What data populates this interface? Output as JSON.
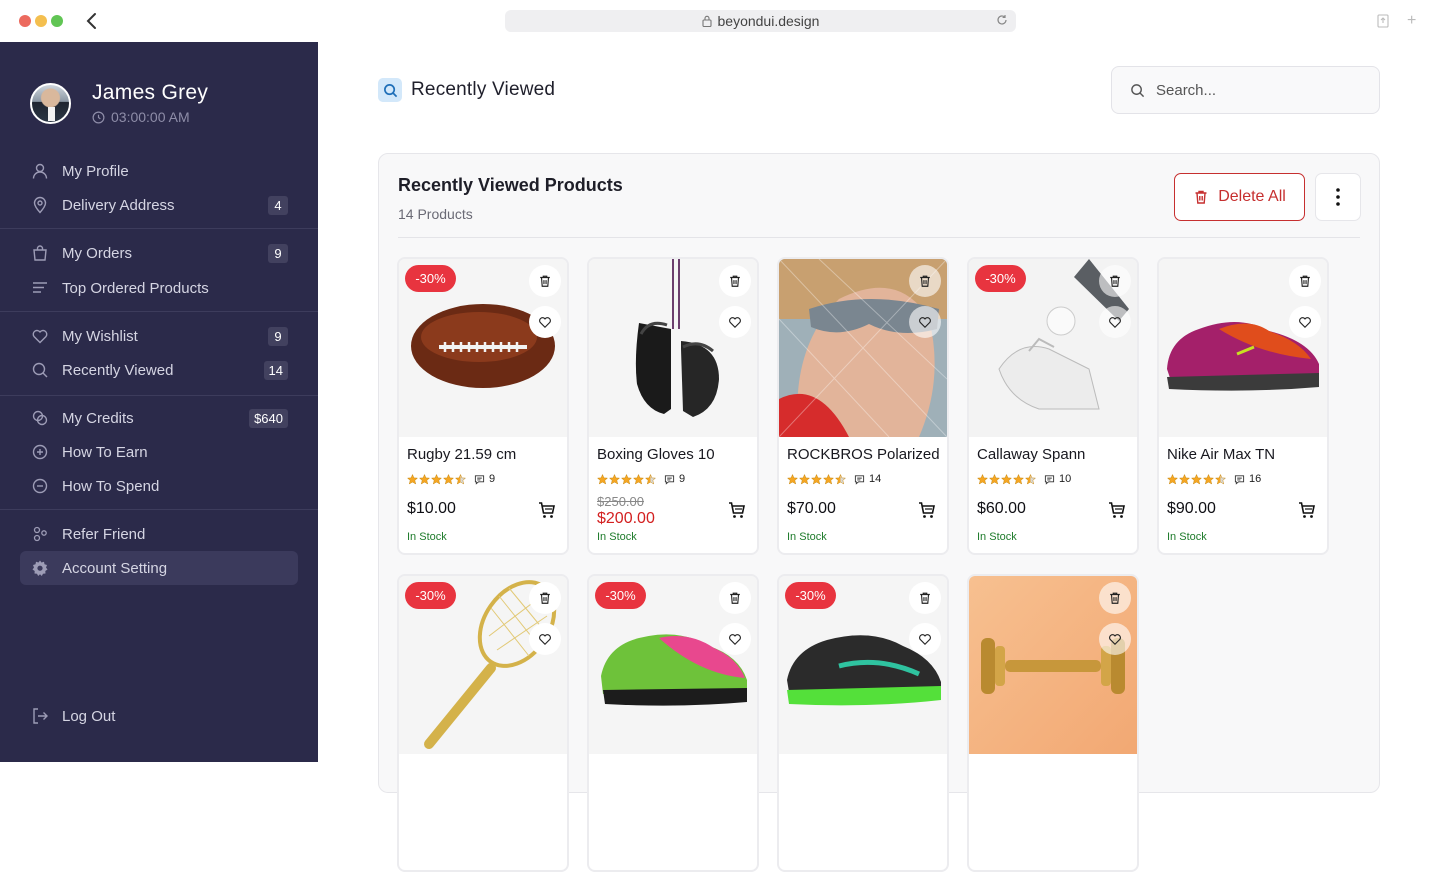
{
  "browser": {
    "url": "beyondui.design"
  },
  "user": {
    "name": "James Grey",
    "time": "03:00:00 AM"
  },
  "sidebar": {
    "items": [
      {
        "label": "My Profile",
        "icon": "user-icon"
      },
      {
        "label": "Delivery Address",
        "icon": "location-pin-icon",
        "badge": "4"
      },
      {
        "label": "My Orders",
        "icon": "shopping-bag-icon",
        "badge": "9"
      },
      {
        "label": "Top Ordered Products",
        "icon": "list-lines-icon"
      },
      {
        "label": "My Wishlist",
        "icon": "heart-icon",
        "badge": "9"
      },
      {
        "label": "Recently Viewed",
        "icon": "search-icon",
        "badge": "14"
      },
      {
        "label": "My Credits",
        "icon": "coins-icon",
        "badge": "$640"
      },
      {
        "label": "How To Earn",
        "icon": "coin-plus-icon"
      },
      {
        "label": "How To Spend",
        "icon": "coin-minus-icon"
      },
      {
        "label": "Refer Friend",
        "icon": "users-icon"
      },
      {
        "label": "Account Setting",
        "icon": "gear-icon"
      }
    ],
    "logout": "Log Out"
  },
  "header": {
    "title": "Recently Viewed",
    "search_placeholder": "Search..."
  },
  "panel": {
    "title": "Recently Viewed Products",
    "subtitle": "14 Products",
    "delete_label": "Delete All"
  },
  "products": [
    {
      "name": "Rugby 21.59 cm",
      "reviews": "9",
      "price": "$10.00",
      "stock": "In Stock",
      "discount": "-30%",
      "rating": 4.5
    },
    {
      "name": "Boxing Gloves 10",
      "reviews": "9",
      "old_price": "$250.00",
      "price": "$200.00",
      "stock": "In Stock",
      "rating": 4.5
    },
    {
      "name": "ROCKBROS Polarized",
      "reviews": "14",
      "price": "$70.00",
      "stock": "In Stock",
      "rating": 4.5
    },
    {
      "name": "Callaway Spann",
      "reviews": "10",
      "price": "$60.00",
      "stock": "In Stock",
      "discount": "-30%",
      "rating": 4.5
    },
    {
      "name": "Nike Air Max TN",
      "reviews": "16",
      "price": "$90.00",
      "stock": "In Stock",
      "rating": 4.5
    },
    {
      "name": "",
      "discount": "-30%"
    },
    {
      "name": "",
      "discount": "-30%"
    },
    {
      "name": "",
      "discount": "-30%"
    },
    {
      "name": ""
    }
  ],
  "colors": {
    "sidebar_bg": "#2b2a4a",
    "discount": "#e8343f",
    "star": "#f5a623",
    "stock": "#1e7b2b",
    "sale": "#d32020",
    "delete": "#c62f2f"
  }
}
